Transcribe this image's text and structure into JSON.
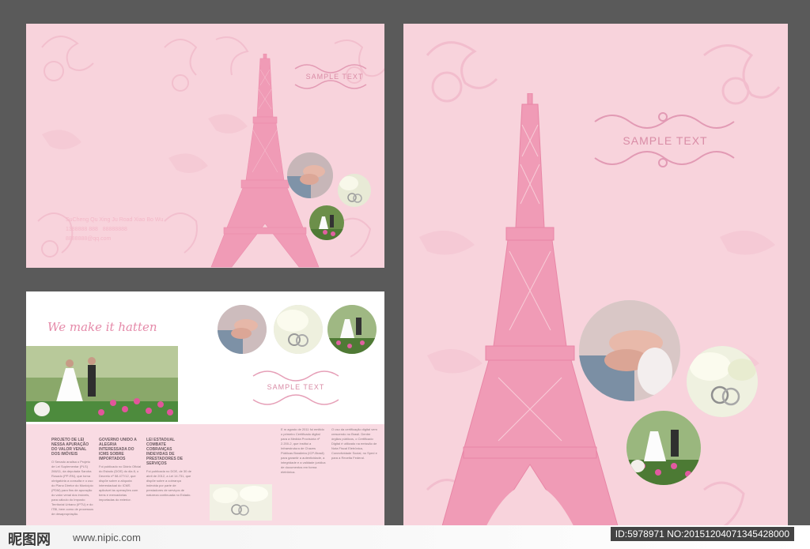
{
  "colors": {
    "page_bg": "#5a5a5a",
    "panel_pink": "#f8d3dc",
    "tower": "#f09bb6",
    "tower_dark": "#ea86a6"
  },
  "cover_left": {
    "sample_text": "SAMPLE TEXT",
    "contact": {
      "address": "SuCheng Qu Xing Ju Road Xiao Bo Wu",
      "phone": "1388888 888",
      "phone2": "88888888",
      "email": "8888888@qq.com"
    }
  },
  "spread": {
    "caption": "We make it hatten",
    "sample_text": "SAMPLE TEXT",
    "col1_heading": "PROJETO DE LEI NESSA APURAÇÃO DO VALOR VENAL DOS IMÓVEIS",
    "col2_heading": "GOVERNO UNIDO A ALEGRIA INTERESSADA DO ICMS SOBRE IMPORTADOS",
    "col3_heading": "LEI ESTADUAL COMBATE COBRANÇAS INDEVIDAS DE PRESTADORES DE SERVIÇOS",
    "col1_body": "O Senado analisa o Projeto de Lei Suplementar (PLS) 266/11, da deputada Sandra Rosado (PP-RN), que torna obrigatória a consulta e o uso do Plano Diretor do Município (PDM) para fins de apuração do valor venal dos imóveis, para cálculo do Imposto Territorial Urbano (IPTU) e do ITBI, bem como de processos de desapropriação.",
    "col2_body": "Foi publicado no Diário Oficial do Estado (DOE) do dia 8, o Decreto nº 58.477/12, que dispõe sobre a alíquota interestadual do ICMS aplicável às operações com bens e mercadorias importadas do exterior.",
    "col3_body": "Foi publicada no DOE, de 30 de abril de 2012, a Lei 14.731, que dispõe sobre a cobrança indevida por parte de prestadores de serviços de natureza continuada no Estado.",
    "col4_body": "E m agosto de 2011 foi emitido o primeiro Certificado digital para a Medida Provisória nº 2.200-2, que institui a Infraestrutura de Chaves Públicas Brasileira (ICP-Brasil) para garantir a autenticidade, a integridade e a validade jurídica de documentos em forma eletrônica.",
    "col5_body": "O uso da certificação digital vem crescendo no Brasil. Dentre órgãos públicos, o Certificado Digital é utilizado na emissão de Nota Fiscal Eletrônica, Conectividade Social, no Sped e para a Receita Federal."
  },
  "cover_right": {
    "sample_text": "SAMPLE TEXT"
  },
  "footer": {
    "logo": "昵图网",
    "url": "www.nipic.com",
    "id_text": "ID:5978971 NO:20151204071345428000"
  }
}
